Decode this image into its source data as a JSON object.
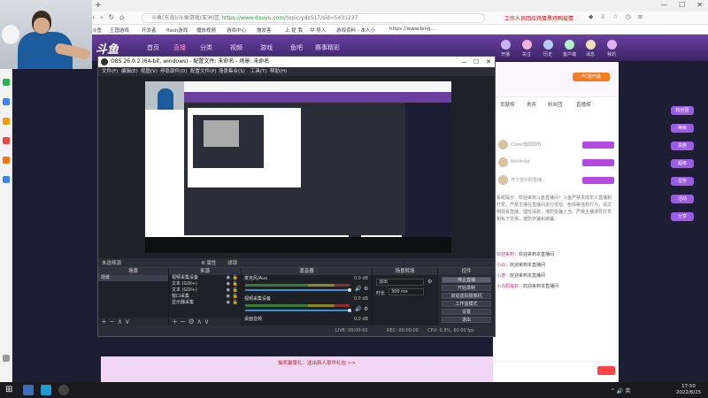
{
  "browser": {
    "new_tab": "+",
    "url_host": "https://www.douyu.com",
    "url_path": "/topic/ydsS17/sid=5431237",
    "url_prefix": "斗鱼(东海)/斗鱼游戏(亚洲)区",
    "right_text": "工作人员回应鸡蛋黑鸡鸭疫情",
    "bookmarks": [
      "斗鱼",
      "王国游戏",
      "开发者",
      "flash游戏",
      "播放视频",
      "游戏中心",
      "撸发客",
      "上 提 我",
      "中 导入",
      "游戏资料 - 本人小",
      "https://www.bing..."
    ],
    "win_controls": [
      "—",
      "☐",
      "✕"
    ]
  },
  "site": {
    "logo": "斗鱼",
    "nav": [
      "首页",
      "直播",
      "分类",
      "视频",
      "游戏",
      "鱼吧",
      "赛事精彩"
    ],
    "active_nav": "直播",
    "header_icons": [
      "开播",
      "关注",
      "历史",
      "客户端",
      "消息",
      "我的"
    ],
    "pc_button": "PC端开播",
    "panel_tabs": [
      "贡献榜",
      "贵宾",
      "粉丝团",
      "直播榜"
    ],
    "rank_rows": [
      "Coser阳阳阳阳",
      "Nishirika",
      "粤下雪中的雪魂"
    ],
    "chat_notice": "系统提示：欢迎来到斗鱼直播间！斗鱼严禁未成年人直播和打赏，严禁主播在直播间进行低俗、色情等违规行为，请文明观看直播，理性消费，谨防受骗上当。严禁主播诱导打赏和私下交易，谨防诈骗和被骗。",
    "chat_messages": [
      {
        "user": "欢迎来到：",
        "text": "欢迎来到本直播间"
      },
      {
        "user": "小白：",
        "text": "欢迎来到本直播间"
      },
      {
        "user": "小游：",
        "text": "欢迎来到本直播间"
      },
      {
        "user": "小乌鸦最好：",
        "text": "欢迎来到本直播间"
      }
    ],
    "banner_text": "抽奖赢豪礼：送出新人豪华礼包 >>",
    "side_badges": [
      "粉丝团",
      "等级",
      "贵族",
      "超级",
      "任务",
      "活动",
      "分享"
    ]
  },
  "obs": {
    "title": "OBS 26.0.2 (64-bit, windows) - 配置文件: 未命名 - 场景: 未命名",
    "menu": [
      "文件(F)",
      "编辑(E)",
      "视图(V)",
      "停靠部件(D)",
      "配置文件(P)",
      "场景集合(S)",
      "工具(T)",
      "帮助(H)"
    ],
    "window_controls": [
      "—",
      "☐",
      "✕"
    ],
    "scene_strip": {
      "label": "未选择源",
      "props": "⚙ 属性",
      "filters": "滤镜"
    },
    "docks": {
      "scenes": {
        "title": "场景",
        "items": [
          "场景"
        ],
        "footer": "+ − ∧ ∨"
      },
      "sources": {
        "title": "来源",
        "items": [
          "视频采集设备",
          "文本 (GDI+)",
          "文本 (GDI+)",
          "窗口采集",
          "显示器采集"
        ],
        "footer": "+ − ⚙ ∧ ∨"
      },
      "mixer": {
        "title": "混音器",
        "tracks": [
          {
            "name": "麦克风/Aux",
            "db": "0.0 dB"
          },
          {
            "name": "视频采集设备",
            "db": "0.0 dB"
          },
          {
            "name": "桌面音频",
            "db": "0.0 dB"
          }
        ]
      },
      "transitions": {
        "title": "场景转场",
        "type": "淡出",
        "duration_label": "时长",
        "duration_value": "300 ms"
      },
      "controls": {
        "title": "控件",
        "buttons": [
          "停止直播",
          "开始录制",
          "启动虚拟摄像机",
          "工作室模式",
          "设置",
          "退出"
        ]
      }
    },
    "status": {
      "live": "LIVE: 00:00:00",
      "rec": "REC: 00:00:00",
      "cpu": "CPU: 0.3%, 60.00 fps"
    }
  },
  "taskbar": {
    "time": "17:50",
    "date": "2022/6/25",
    "tray": "^ 🔊 英"
  }
}
